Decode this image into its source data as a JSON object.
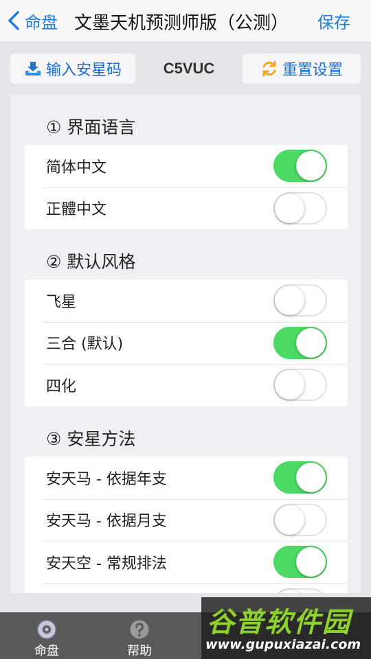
{
  "navbar": {
    "back_label": "命盘",
    "title": "文墨天机预测师版（公测）",
    "save_label": "保存"
  },
  "toolbar": {
    "input_label": "输入安星码",
    "code": "C5VUC",
    "reset_label": "重置设置"
  },
  "sections": [
    {
      "title": "① 界面语言",
      "rows": [
        {
          "label": "简体中文",
          "on": true
        },
        {
          "label": "正體中文",
          "on": false
        }
      ]
    },
    {
      "title": "② 默认风格",
      "rows": [
        {
          "label": "飞星",
          "on": false
        },
        {
          "label": "三合 (默认)",
          "on": true
        },
        {
          "label": "四化",
          "on": false
        }
      ]
    },
    {
      "title": "③ 安星方法",
      "rows": [
        {
          "label": "安天马 - 依据年支",
          "on": true
        },
        {
          "label": "安天马 - 依据月支",
          "on": false
        },
        {
          "label": "安天空 - 常规排法",
          "on": true
        }
      ]
    }
  ],
  "tabbar": {
    "tab1": "命盘",
    "tab2": "帮助"
  },
  "watermark": {
    "logo": "谷普软件园",
    "url": "www.gupuxiazai.com"
  },
  "colors": {
    "accent": "#1a7fe0",
    "toggle_on": "#4cd964"
  }
}
